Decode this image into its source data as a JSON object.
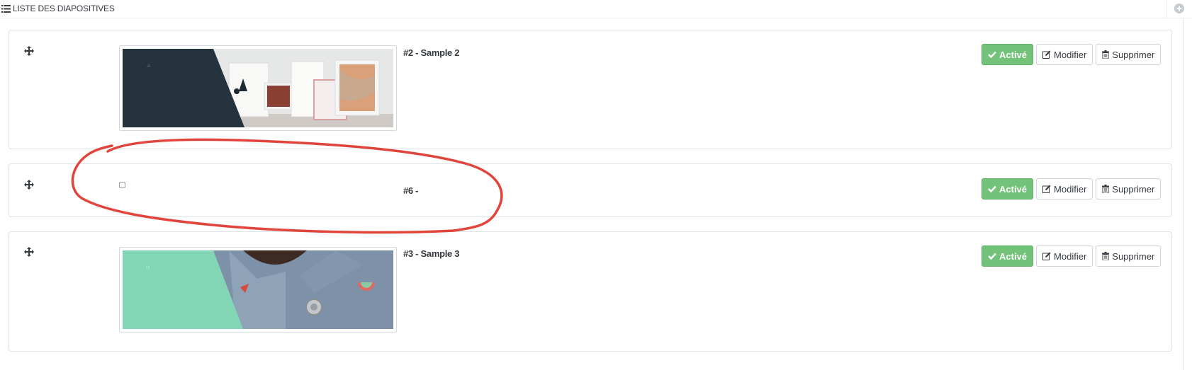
{
  "panel": {
    "title": "LISTE DES DIAPOSITIVES",
    "icons": {
      "heading": "list-icon",
      "add": "plus-circle-icon"
    }
  },
  "slides": [
    {
      "title": "#2 - Sample 2",
      "has_image": true,
      "image_subject": "dark slate panel with logo next to framed prints leaning on a wall",
      "actions": {
        "status": "Activé",
        "edit": "Modifier",
        "delete": "Supprimer"
      }
    },
    {
      "title": "#6 -",
      "has_image": false,
      "actions": {
        "status": "Activé",
        "edit": "Modifier",
        "delete": "Supprimer"
      }
    },
    {
      "title": "#3 - Sample 3",
      "has_image": true,
      "image_subject": "mint green panel with quote mark next to denim jacket with watermelon pins",
      "actions": {
        "status": "Activé",
        "edit": "Modifier",
        "delete": "Supprimer"
      }
    }
  ],
  "colors": {
    "active_button": "#72c279",
    "annotation": "#e0443b",
    "slide2_panel": "#25333e",
    "slide3_panel": "#82d6b6"
  }
}
